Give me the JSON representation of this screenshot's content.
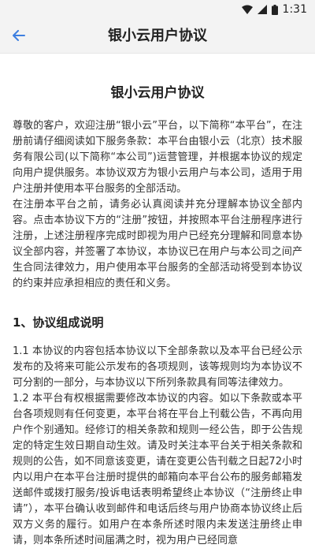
{
  "status_bar": {
    "time": "1:31"
  },
  "app_bar": {
    "title": "银小云用户协议"
  },
  "document": {
    "title": "银小云用户协议",
    "intro": [
      "尊敬的客户，欢迎注册“银小云”平台，以下简称“本平台”，在注册前请仔细阅读如下服务条款：本平台由银小云（北京）技术服务有限公司(以下简称“本公司”)运营管理，并根据本协议的规定向用户提供服务。本协议双方为银小云用户与本公司，适用于用户注册并使用本平台服务的全部活动。",
      "在注册本平台之前，请务必认真阅读并充分理解本协议全部内容。点击本协议下方的“注册”按钮，并按照本平台注册程序进行注册，上述注册程序完成时即视为用户已经充分理解和同意本协议全部内容，并签署了本协议，本协议已在用户与本公司之间产生合同法律效力，用户使用本平台服务的全部活动将受到本协议的约束并应承担相应的责任和义务。"
    ],
    "section1": {
      "title": "1、协议组成说明",
      "paragraphs": [
        "1.1 本协议的内容包括本协议以下全部条款以及本平台已经公示发布的及将来可能公示发布的各项规则，该等规则均为本协议不可分割的一部分，与本协议以下所列条款具有同等法律效力。",
        "1.2 本平台有权根据需要修改本协议的内容。如以下条款或本平台各项规则有任何变更，本平台将在平台上刊载公告，不再向用户作个别通知。经修订的相关条款和规则一经公告，即于公告规定的特定生效日期自动生效。请及时关注本平台关于相关条款和规则的公告，如不同意该变更，请在变更公告刊载之日起72小时内以用户在本平台注册时提供的邮箱向本平台公布的服务邮箱发送邮件或拨打服务/投诉电话表明希望终止本协议（“注册终止申请”），本平台确认收到邮件和电话后终与用户协商本协议终止后双方义务的履行。如用户在本条所述时限内未发送注册终止申请，则本条所述时间届满之时，视为用户已经同意"
      ]
    }
  }
}
